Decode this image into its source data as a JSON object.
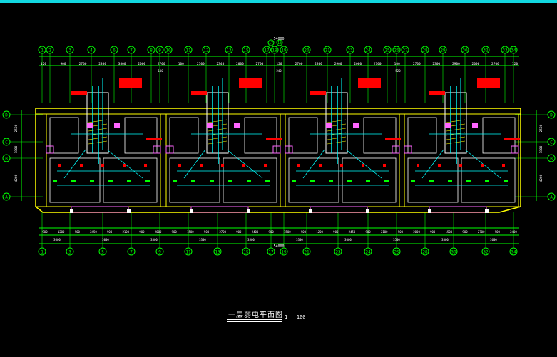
{
  "drawing": {
    "title": "一层弱电平面图",
    "scale": "1 : 100"
  },
  "colors": {
    "background": "#000000",
    "axis": "#00ff00",
    "wall": "#ffff00",
    "cabling": "#00ffff",
    "pink": "#ff66ff",
    "white": "#ffffff",
    "red": "#ff0000",
    "top_band": "#12d8e0"
  },
  "axes": {
    "top_row": [
      "1",
      "2",
      "3",
      "4",
      "6",
      "7",
      "8",
      "9",
      "10",
      "11",
      "12",
      "13",
      "15",
      "17",
      "18",
      "19",
      "20",
      "21",
      "23",
      "24",
      "25",
      "26",
      "27",
      "28",
      "29",
      "30",
      "32",
      "33",
      "34"
    ],
    "bottom_row": [
      "1",
      "3",
      "5",
      "7",
      "9",
      "11",
      "13",
      "15",
      "17",
      "19",
      "21",
      "23",
      "24",
      "25",
      "28",
      "30",
      "32",
      "34"
    ],
    "left_rows": [
      "D",
      "C",
      "B",
      "A"
    ],
    "right_rows": [
      "D",
      "C",
      "B",
      "A"
    ]
  },
  "dimensions": {
    "top_segments": [
      "120",
      "900",
      "2700",
      "2300",
      "3800",
      "2000",
      "2700",
      "100",
      "2700",
      "2340",
      "2000",
      "2700",
      "120",
      "2700",
      "2300",
      "2900",
      "2000",
      "2700",
      "100",
      "2700",
      "2300",
      "2900",
      "2000",
      "2700",
      "120"
    ],
    "top_total": "54000",
    "bottom_segments": [
      "900",
      "1200",
      "900",
      "2450",
      "900",
      "2100",
      "900",
      "2000",
      "900",
      "1500",
      "900",
      "2700",
      "900",
      "2400",
      "900",
      "1500",
      "900",
      "1200",
      "900",
      "2450",
      "900",
      "2100",
      "900",
      "2000",
      "900",
      "1500",
      "900",
      "2700",
      "900",
      "2400"
    ],
    "bottom_major": [
      "3600",
      "3000",
      "3300",
      "3300",
      "3500",
      "3300",
      "3000",
      "3500",
      "3300",
      "3600"
    ],
    "bottom_total": "54000",
    "left_vertical": [
      "2500",
      "1800",
      "4200"
    ],
    "right_vertical": [
      "2500",
      "1800",
      "4200"
    ]
  }
}
